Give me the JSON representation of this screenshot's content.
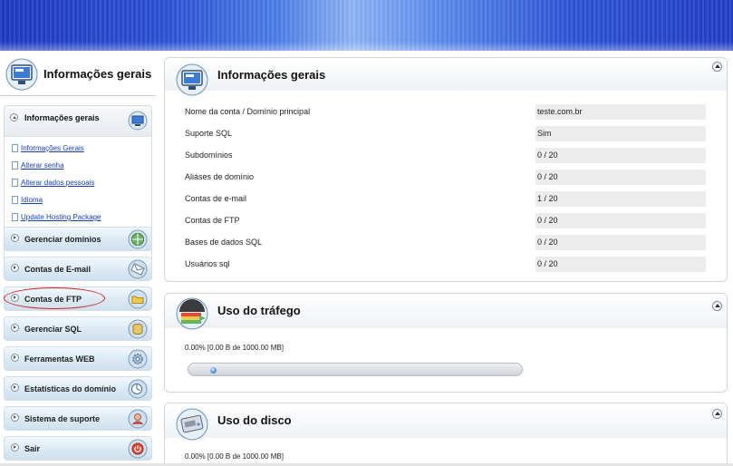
{
  "sidebar": {
    "header_title": "Informações gerais",
    "open_section": {
      "label": "Informações gerais",
      "links": [
        {
          "label": "Informações Gerais"
        },
        {
          "label": "Alterar senha"
        },
        {
          "label": "Alterar dados pessoais"
        },
        {
          "label": "Idioma"
        },
        {
          "label": "Update Hosting Package"
        }
      ]
    },
    "items": [
      {
        "label": "Gerenciar domínios",
        "icon": "globe-icon"
      },
      {
        "label": "Contas de E-mail",
        "icon": "email-icon"
      },
      {
        "label": "Contas de FTP",
        "icon": "folder-icon",
        "highlighted": true
      },
      {
        "label": "Gerenciar SQL",
        "icon": "database-icon"
      },
      {
        "label": "Ferramentas WEB",
        "icon": "tools-icon"
      },
      {
        "label": "Estatísticas do domínio",
        "icon": "statistics-icon"
      },
      {
        "label": "Sistema de suporte",
        "icon": "support-icon"
      },
      {
        "label": "Sair",
        "icon": "power-icon"
      }
    ],
    "highlight_color": "#d32020"
  },
  "main": {
    "general": {
      "title": "Informações gerais",
      "rows": [
        {
          "label": "Nome da conta / Domínio principal",
          "value": "teste.com.br"
        },
        {
          "label": "Suporte SQL",
          "value": "Sim"
        },
        {
          "label": "Subdomínios",
          "value": "0 / 20"
        },
        {
          "label": "Aliáses de domínio",
          "value": "0 / 20"
        },
        {
          "label": "Contas de e-mail",
          "value": "1 / 20"
        },
        {
          "label": "Contas de FTP",
          "value": "0 / 20"
        },
        {
          "label": "Bases de dados SQL",
          "value": "0 / 20"
        },
        {
          "label": "Usuários sql",
          "value": "0 / 20"
        }
      ]
    },
    "traffic": {
      "title": "Uso do tráfego",
      "usage": "0.00% [0.00 B de 1000.00 MB]",
      "percent": 0.0
    },
    "disk": {
      "title": "Uso do disco",
      "usage": "0.00% [0.00 B de 1000.00 MB]"
    }
  },
  "colors": {
    "banner_blue": "#2d52d6",
    "link": "#1a40b8",
    "value_bg": "#ececec",
    "sidebar_item_bg": "#dbe9f3"
  }
}
